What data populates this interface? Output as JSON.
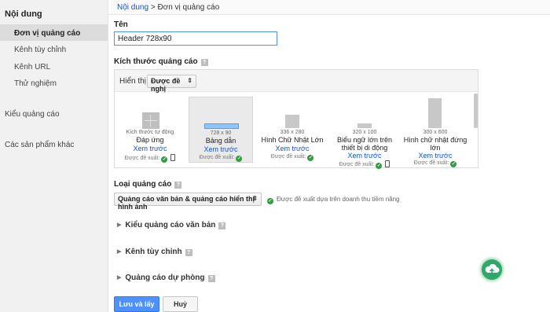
{
  "sidebar": {
    "section_title": "Nội dung",
    "items": [
      {
        "label": "Đơn vị quảng cáo"
      },
      {
        "label": "Kênh tùy chỉnh"
      },
      {
        "label": "Kênh URL"
      },
      {
        "label": "Thử nghiệm"
      }
    ],
    "top_items": [
      {
        "label": "Kiểu quảng cáo"
      },
      {
        "label": "Các sản phẩm khác"
      }
    ]
  },
  "breadcrumb": {
    "link": "Nội dung",
    "separator": ">",
    "current": "Đơn vị quảng cáo"
  },
  "form": {
    "name_label": "Tên",
    "name_value": "Header 728x90",
    "size_label": "Kích thước quảng cáo",
    "help_glyph": "?",
    "show_label": "Hiển thị",
    "show_value": "Được đề nghị",
    "sizes": [
      {
        "size": "Kích thước tự động",
        "name": "Đáp ứng",
        "preview": "Xem trước",
        "recommended": "Được đề xuất:",
        "mobile": true,
        "selected": false
      },
      {
        "size": "728 x 90",
        "name": "Bảng dẫn",
        "preview": "Xem trước",
        "recommended": "Được đề xuất:",
        "mobile": false,
        "selected": true
      },
      {
        "size": "336 x 280",
        "name": "Hình Chữ Nhật Lớn",
        "preview": "Xem trước",
        "recommended": "Được đề xuất:",
        "mobile": false,
        "selected": false
      },
      {
        "size": "320 x 100",
        "name": "Biểu ngữ lớn trên thiết bị di động",
        "preview": "Xem trước",
        "recommended": "Được đề xuất:",
        "mobile": true,
        "selected": false
      },
      {
        "size": "300 x 600",
        "name": "Hình chữ nhật đứng lớn",
        "preview": "Xem trước",
        "recommended": "Được đề xuất:",
        "mobile": false,
        "selected": false
      }
    ],
    "type_label": "Loại quảng cáo",
    "type_value": "Quảng cáo văn bản & quảng cáo hiển thị hình ảnh",
    "type_note": "Được đề xuất dựa trên doanh thu tiềm năng",
    "sections": [
      {
        "label": "Kiểu quảng cáo văn bản"
      },
      {
        "label": "Kênh tùy chỉnh"
      },
      {
        "label": "Quảng cáo dự phòng"
      }
    ]
  },
  "actions": {
    "save_label": "Lưu và lấy mã",
    "cancel_label": "Huỷ"
  },
  "colors": {
    "accent": "#4d90fe",
    "link": "#1155cc",
    "check": "#2e9e3e"
  }
}
